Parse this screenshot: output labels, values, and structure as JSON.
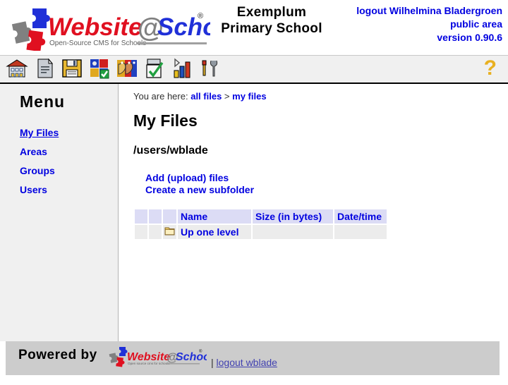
{
  "header": {
    "logo_alt": "websiteatschool-logo",
    "logo_wordmark": "Website@School",
    "logo_tagline": "Open-Source CMS for Schools",
    "logo_registered": "®",
    "school_name_line1": "Exemplum",
    "school_name_line2": "Primary School",
    "logout_label": "logout Wilhelmina Bladergroen",
    "area_label": "public area",
    "version_label": "version 0.90.6"
  },
  "toolbar": {
    "icons": [
      {
        "name": "home-icon",
        "title": "home"
      },
      {
        "name": "page-icon",
        "title": "pages"
      },
      {
        "name": "save-icon",
        "title": "file manager"
      },
      {
        "name": "modules-icon",
        "title": "modules"
      },
      {
        "name": "groups-icon",
        "title": "groups"
      },
      {
        "name": "tasks-icon",
        "title": "tasks"
      },
      {
        "name": "statistics-icon",
        "title": "statistics"
      },
      {
        "name": "tools-icon",
        "title": "tools"
      }
    ],
    "help_label": "?"
  },
  "sidebar": {
    "title": "Menu",
    "items": [
      {
        "label": "My Files",
        "current": true
      },
      {
        "label": "Areas",
        "current": false
      },
      {
        "label": "Groups",
        "current": false
      },
      {
        "label": "Users",
        "current": false
      }
    ]
  },
  "main": {
    "breadcrumb_prefix": "You are here:",
    "breadcrumb": [
      {
        "label": "all files"
      },
      {
        "label": "my files"
      }
    ],
    "breadcrumb_separator": ">",
    "page_title": "My Files",
    "path": "/users/wblade",
    "actions": [
      {
        "label": "Add (upload) files"
      },
      {
        "label": "Create a new subfolder"
      }
    ],
    "table": {
      "columns": [
        "",
        "",
        "",
        "Name",
        "Size (in bytes)",
        "Date/time"
      ],
      "rows": [
        {
          "check": "",
          "col2": "",
          "icon": "folder-icon",
          "name": "Up one level",
          "size": "",
          "datetime": ""
        }
      ]
    }
  },
  "footer": {
    "powered_by": "Powered by",
    "logo_wordmark": "Website@School",
    "logo_tagline": "Open source cms for schools",
    "logo_registered": "®",
    "separator": "|",
    "logout_label": "logout wblade"
  },
  "colors": {
    "link": "#0000e0",
    "header_text": "#000000",
    "toolbar_bg": "#f0f0f0",
    "sidebar_bg": "#f0f0f0",
    "table_header_bg": "#dcdcf5",
    "table_row_bg": "#ececec",
    "footer_bg": "#cccccc",
    "help_icon": "#e8b020"
  }
}
